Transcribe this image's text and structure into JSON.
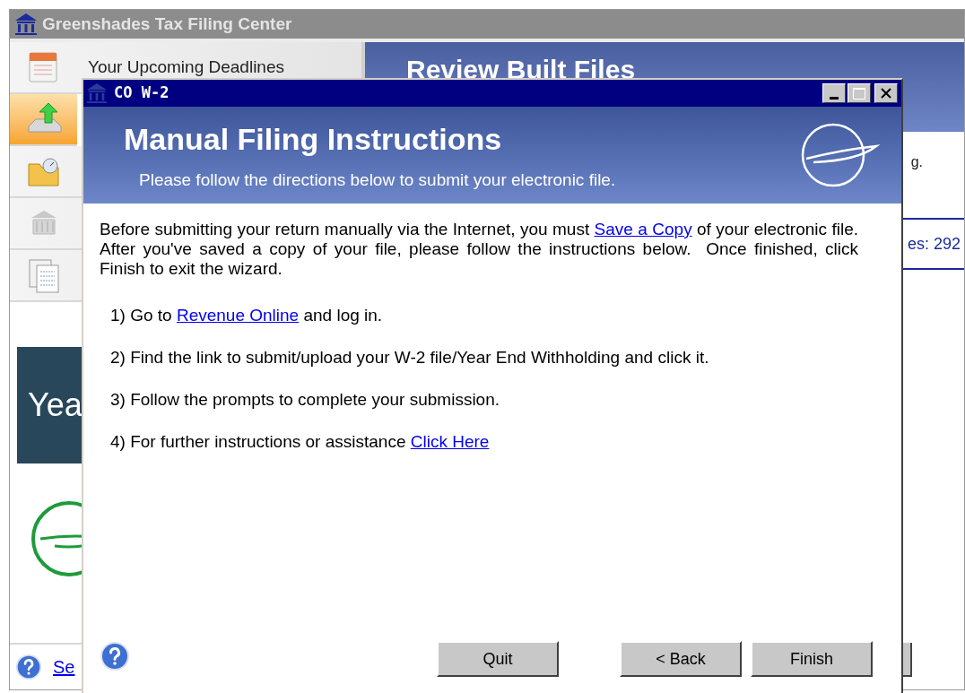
{
  "app_window": {
    "title": "Greenshades Tax Filing Center",
    "sidebar": {
      "items": [
        {
          "kind": "calendar",
          "label": "Your Upcoming Deadlines",
          "selected": false
        },
        {
          "kind": "upload",
          "selected": true
        },
        {
          "kind": "folder",
          "selected": false
        },
        {
          "kind": "building",
          "selected": false
        },
        {
          "kind": "documents",
          "selected": false
        }
      ],
      "banner": "Yea",
      "footer_link": "Se"
    },
    "main": {
      "heading": "Review Built Files",
      "text_fragment": "g.",
      "link_fragment": "es: 292"
    }
  },
  "dialog": {
    "title": "CO W-2",
    "header": {
      "title": "Manual Filing Instructions",
      "subtitle": "Please follow the directions below to submit your electronic file."
    },
    "intro": [
      {
        "kind": "text",
        "text": "Before submitting your return manually via the Internet, you must "
      },
      {
        "kind": "link",
        "text": "Save a Copy"
      },
      {
        "kind": "text",
        "text": " of your electronic file.  After you've saved a copy of your file, please follow the instructions below.  Once finished, click Finish to exit the wizard."
      }
    ],
    "steps": [
      [
        {
          "kind": "text",
          "text": "1) Go to "
        },
        {
          "kind": "link",
          "text": "Revenue Online"
        },
        {
          "kind": "text",
          "text": " and log in."
        }
      ],
      [
        {
          "kind": "text",
          "text": "2) Find the link to submit/upload your W-2 file/Year End Withholding and click it."
        }
      ],
      [
        {
          "kind": "text",
          "text": "3) Follow the prompts to complete your submission."
        }
      ],
      [
        {
          "kind": "text",
          "text": "4) For further instructions or assistance "
        },
        {
          "kind": "link",
          "text": "Click Here"
        }
      ]
    ],
    "buttons": [
      {
        "label": "Quit"
      },
      {
        "label": "< Back"
      },
      {
        "label": "Finish"
      }
    ]
  }
}
